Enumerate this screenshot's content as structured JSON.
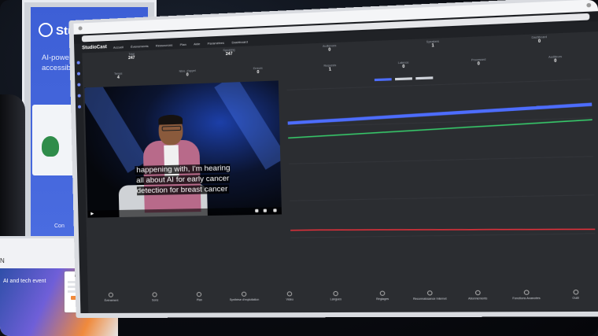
{
  "banner": {
    "brand": "StudioCast.ai",
    "tagline": "AI-powered translation and accessibility for digital",
    "bottom_text": "Con"
  },
  "tablet": {
    "letter": "N",
    "hero_text": "AI and tech event",
    "register_title": "Register"
  },
  "app": {
    "logo": "StudioCast",
    "nav": [
      "Accueil",
      "Évènements",
      "Ressources",
      "Plan",
      "Aide",
      "Paramètres",
      "Dashboard"
    ],
    "stats_top": [
      {
        "label": "Total",
        "value": "247"
      },
      {
        "label": "Speaking",
        "value": "247"
      },
      {
        "label": "Audiences",
        "value": "0"
      },
      {
        "label": "Speakers",
        "value": "1"
      },
      {
        "label": "Dashboard",
        "value": "0"
      }
    ],
    "stats_second": [
      {
        "label": "Temps",
        "value": "4"
      },
      {
        "label": "Nbre. d'appel",
        "value": "0"
      },
      {
        "label": "Erreurs",
        "value": "0"
      },
      {
        "label": "Requests",
        "value": "1"
      },
      {
        "label": "Latence",
        "value": "0"
      },
      {
        "label": "Processed",
        "value": "0"
      },
      {
        "label": "Auditeurs",
        "value": "0"
      }
    ],
    "caption": "happening with, I'm hearing all about AI for early cancer detection for breast cancer",
    "footer": [
      "Événement",
      "Sons",
      "Plan",
      "Synthèse d'exploitation",
      "Vidéo",
      "Langues",
      "Réglages",
      "Reconnaissance Internet",
      "Abonnements",
      "Fonctions Avancées",
      "Outil"
    ]
  },
  "colors": {
    "brand_blue": "#4a6ce0",
    "series_blue": "#4d6dff",
    "series_green": "#37c96a",
    "series_red": "#e0303a"
  },
  "chart_data": {
    "type": "line",
    "title": "",
    "xlabel": "",
    "ylabel": "",
    "series": [
      {
        "values": [
          62,
          62.5,
          63,
          63.5,
          64,
          64.5,
          65,
          65.5,
          66,
          66.5,
          67
        ]
      },
      {
        "values": [
          54,
          54.5,
          55,
          55.5,
          56,
          56.5,
          57,
          57.5,
          58,
          58.5,
          59
        ]
      },
      {
        "values": [
          4,
          4,
          3.8,
          3.6,
          3.4,
          3.2,
          3,
          2.8,
          2.6,
          2.4,
          2.2
        ]
      }
    ],
    "ylim": [
      0,
      80
    ]
  }
}
